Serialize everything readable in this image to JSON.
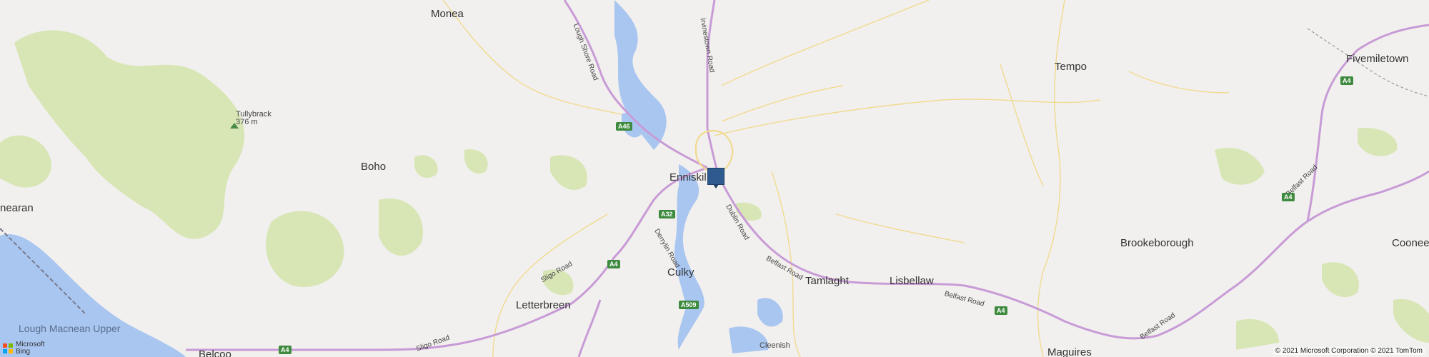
{
  "colors": {
    "background": "#f1f0ee",
    "forest": "#d8e6b6",
    "water": "#a9c6f1",
    "main_road": "#c89bd6",
    "minor_road": "#f1da8f",
    "marker": "#2e5a8f"
  },
  "places": {
    "monea": "Monea",
    "tullybrack": "Tullybrack",
    "tullybrack_height": "376 m",
    "boho": "Boho",
    "nearan": "nearan",
    "enniskillen": "Enniskil",
    "culky": "Culky",
    "letterbreen": "Letterbreen",
    "tamlaght": "Tamlaght",
    "lisbellaw": "Lisbellaw",
    "tempo": "Tempo",
    "fivemiletown": "Fivemiletown",
    "brookeborough": "Brookeborough",
    "cooneen": "Cooneen",
    "maguires": "Maguires",
    "cleenish": "Cleenish",
    "belcoo": "Belcoo",
    "lough_macnean": "Lough Macnean Upper"
  },
  "roads": {
    "lough_shore": "Lough Shore Road",
    "irvinestown": "Irvinestown Road",
    "derrylin": "Derrylin Road",
    "dublin": "Dublin Road",
    "belfast_1": "Belfast Road",
    "belfast_2": "Belfast Road",
    "belfast_3": "Belfast Road",
    "belfast_4": "Belfast Road",
    "sligo_1": "Sligo Road",
    "sligo_2": "Sligo Road"
  },
  "shields": {
    "a46": "A46",
    "a32": "A32",
    "a4_west": "A4",
    "a4_south": "A4",
    "a509": "A509",
    "a4_east": "A4",
    "a4_ne1": "A4",
    "a4_ne2": "A4"
  },
  "attribution": {
    "bing_line1": "Microsoft",
    "bing_line2": "Bing",
    "copyright": "© 2021 Microsoft Corporation © 2021 TomTom"
  }
}
